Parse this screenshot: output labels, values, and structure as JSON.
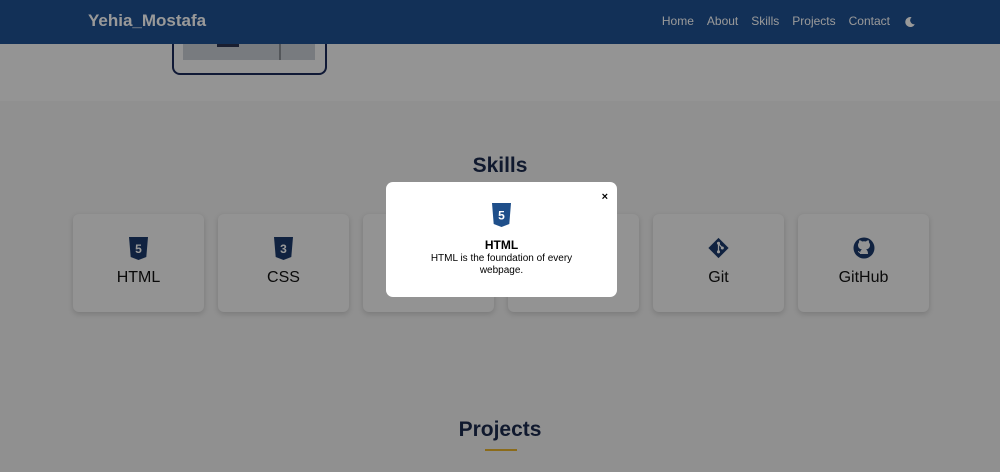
{
  "nav": {
    "brand": "Yehia_Mostafa",
    "links": [
      "Home",
      "About",
      "Skills",
      "Projects",
      "Contact"
    ],
    "theme_icon": "moon-icon"
  },
  "skills": {
    "title": "Skills",
    "cards": [
      {
        "label": "HTML",
        "icon": "html5-icon"
      },
      {
        "label": "CSS",
        "icon": "css3-icon"
      },
      {
        "label": "",
        "icon": ""
      },
      {
        "label": "",
        "icon": ""
      },
      {
        "label": "Git",
        "icon": "git-icon"
      },
      {
        "label": "GitHub",
        "icon": "github-icon"
      }
    ]
  },
  "projects": {
    "title": "Projects"
  },
  "modal": {
    "icon": "html5-icon",
    "title": "HTML",
    "description": "HTML is the foundation of every webpage.",
    "close_label": "×"
  },
  "colors": {
    "navbar": "#1f5192",
    "heading": "#1b2a4e",
    "accent_underline": "#e8b22c",
    "icon": "#1b3a6b"
  }
}
